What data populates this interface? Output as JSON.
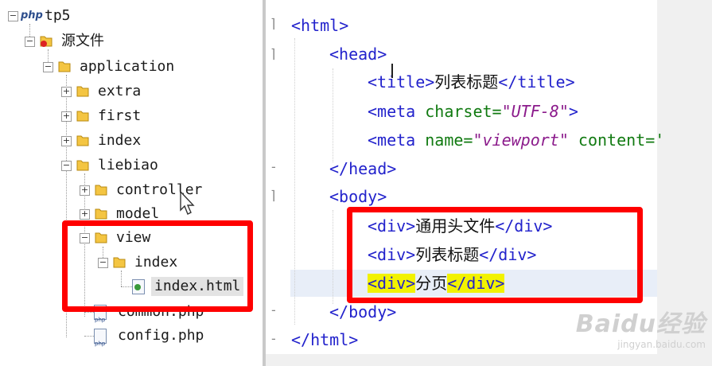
{
  "tree": {
    "nodes": [
      {
        "label": "tp5",
        "icon": "php-project-icon"
      },
      {
        "label": "源文件",
        "icon": "source-folder-icon"
      },
      {
        "label": "application",
        "icon": "folder-icon"
      },
      {
        "label": "extra",
        "icon": "folder-icon"
      },
      {
        "label": "first",
        "icon": "folder-icon"
      },
      {
        "label": "index",
        "icon": "folder-icon"
      },
      {
        "label": "liebiao",
        "icon": "folder-icon"
      },
      {
        "label": "controller",
        "icon": "folder-icon"
      },
      {
        "label": "model",
        "icon": "folder-icon"
      },
      {
        "label": "view",
        "icon": "folder-icon"
      },
      {
        "label": "index",
        "icon": "folder-icon"
      },
      {
        "label": "index.html",
        "icon": "html-file-icon"
      },
      {
        "label": "common.php",
        "icon": "php-file-icon"
      },
      {
        "label": "config.php",
        "icon": "php-file-icon"
      }
    ]
  },
  "editor": {
    "lines": {
      "l1": {
        "tag": "<html>"
      },
      "l2": {
        "tag": "<head>"
      },
      "l3": {
        "open": "<title>",
        "text": "列表标题",
        "close": "</title>"
      },
      "l4": {
        "open": "<meta ",
        "attr": "charset=",
        "val": "\"UTF-8\"",
        "close": ">"
      },
      "l5": {
        "open": "<meta ",
        "attr1": "name=",
        "val1": "\"viewport\"",
        "attr2": " content='"
      },
      "l6": {
        "tag": "</head>"
      },
      "l7": {
        "tag": "<body>"
      },
      "l8": {
        "open": "<div>",
        "text": "通用头文件",
        "close": "</div>"
      },
      "l9": {
        "open": "<div>",
        "text": "列表标题",
        "close": "</div>"
      },
      "l10": {
        "open": "<div>",
        "text": "分页",
        "close": "</div>"
      },
      "l11": {
        "tag": "</body>"
      },
      "l12": {
        "tag": "</html>"
      }
    }
  },
  "watermark": {
    "brand": "Baidu经验",
    "url": "jingyan.baidu.com"
  },
  "colors": {
    "highlight": "#ff0000",
    "tag": "#2222cc",
    "attr": "#117a11",
    "string": "#8b1a8b",
    "match": "#f2f200"
  }
}
